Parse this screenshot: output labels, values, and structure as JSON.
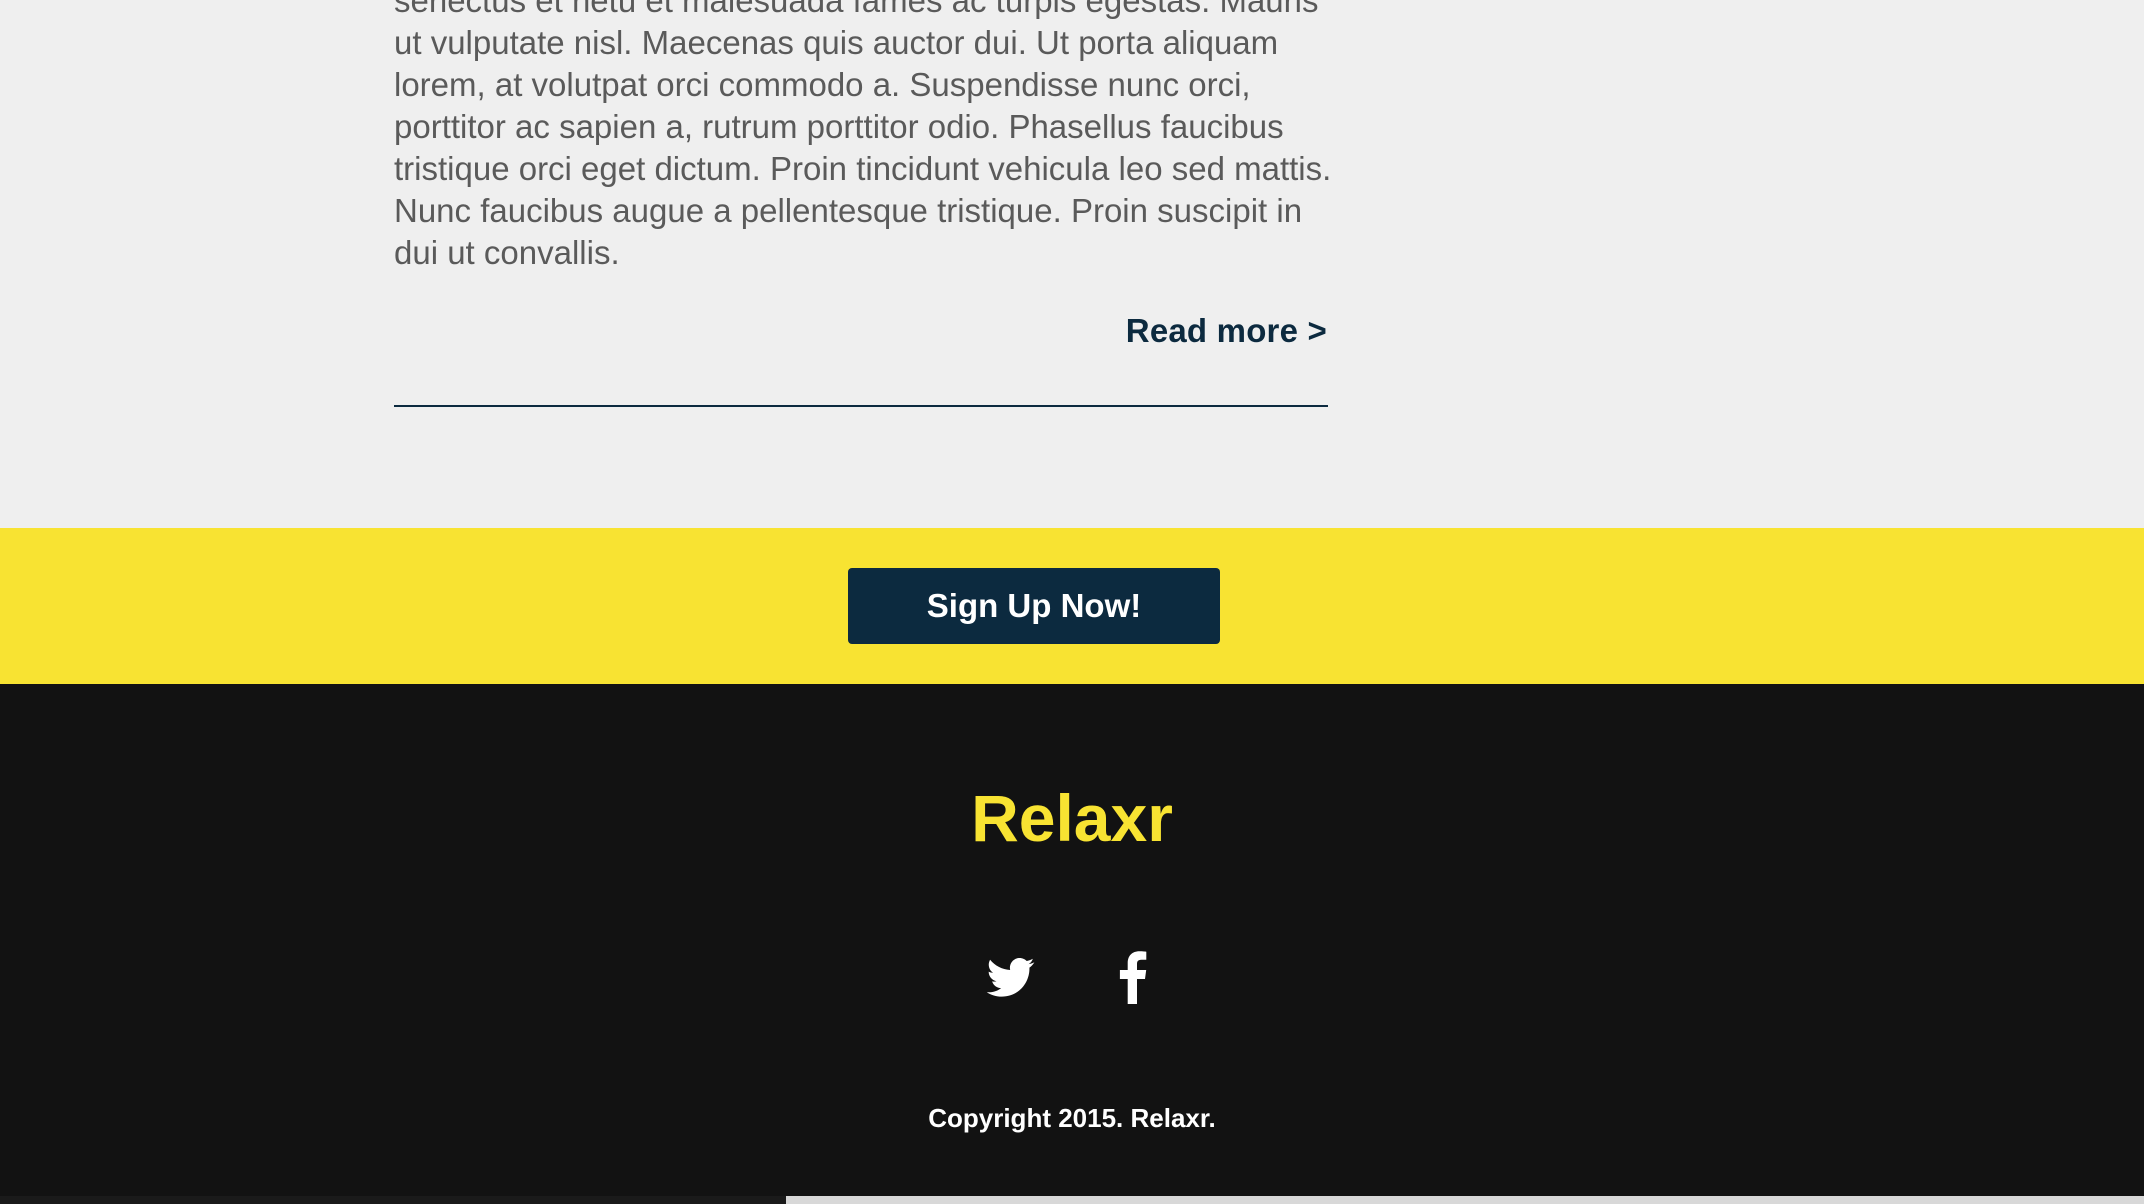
{
  "article": {
    "text": "senectus et netu et malesuada fames ac turpis egestas. Mauris ut vulputate nisl. Maecenas quis auctor dui. Ut porta aliquam lorem, at volutpat orci commodo a. Suspendisse nunc orci, porttitor ac sapien a, rutrum porttitor odio. Phasellus faucibus tristique orci eget dictum. Proin tincidunt vehicula leo sed mattis. Nunc faucibus augue a pellentesque tristique. Proin suscipit in dui ut convallis.",
    "read_more": "Read more >"
  },
  "signup": {
    "button_label": "Sign Up Now!"
  },
  "footer": {
    "logo": "Relaxr",
    "social": [
      {
        "name": "twitter",
        "icon": "twitter-icon"
      },
      {
        "name": "facebook",
        "icon": "facebook-icon"
      }
    ],
    "copyright": "Copyright 2015. Relaxr."
  },
  "colors": {
    "page_background": "#efefef",
    "brand_yellow": "#f8e332",
    "navy": "#0c2a3f",
    "footer_background": "#121212",
    "body_text": "#5a5a5a"
  }
}
